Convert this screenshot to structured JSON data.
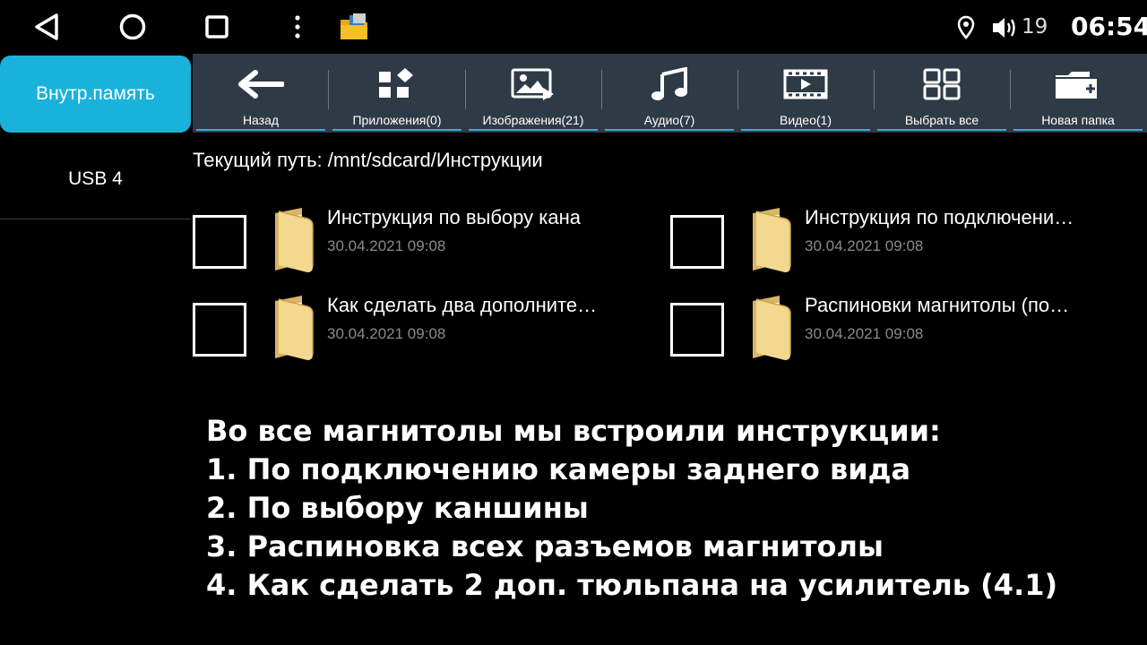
{
  "status": {
    "volume": "19",
    "time": "06:54",
    "icons": [
      "back-icon",
      "home-icon",
      "recent-apps-icon",
      "menu-dots-icon",
      "file-manager-app-icon",
      "location-icon",
      "volume-icon"
    ]
  },
  "sidebar": {
    "items": [
      {
        "label": "Внутр.память",
        "active": true
      },
      {
        "label": "USB 4",
        "active": false
      }
    ]
  },
  "toolbar": {
    "items": [
      {
        "label": "Назад",
        "icon": "arrow-left-icon"
      },
      {
        "label": "Приложения(0)",
        "icon": "apps-icon"
      },
      {
        "label": "Изображения(21)",
        "icon": "images-icon"
      },
      {
        "label": "Аудио(7)",
        "icon": "music-note-icon"
      },
      {
        "label": "Видео(1)",
        "icon": "video-film-icon"
      },
      {
        "label": "Выбрать все",
        "icon": "select-all-icon"
      },
      {
        "label": "Новая папка",
        "icon": "new-folder-icon"
      }
    ]
  },
  "path": "Текущий путь: /mnt/sdcard/Инструкции",
  "files": [
    {
      "name": "Инструкция по выбору кана",
      "date": "30.04.2021 09:08"
    },
    {
      "name": "Инструкция по подключени…",
      "date": "30.04.2021 09:08"
    },
    {
      "name": "Как сделать два дополните…",
      "date": "30.04.2021 09:08"
    },
    {
      "name": "Распиновки магнитолы (по…",
      "date": "30.04.2021 09:08"
    }
  ],
  "caption": {
    "lines": [
      "Во все магнитолы мы встроили инструкции:",
      "1. По подключению камеры заднего вида",
      "2. По выбору каншины",
      "3. Распиновка всех разъемов магнитолы",
      "4. Как сделать 2 доп. тюльпана на усилитель (4.1)"
    ]
  },
  "colors": {
    "accent": "#1ab2db",
    "toolbar_bg": "#2f3a47",
    "underline": "#3fa9d6",
    "date_text": "#8a8a8a",
    "folder": "#f3d88f"
  }
}
